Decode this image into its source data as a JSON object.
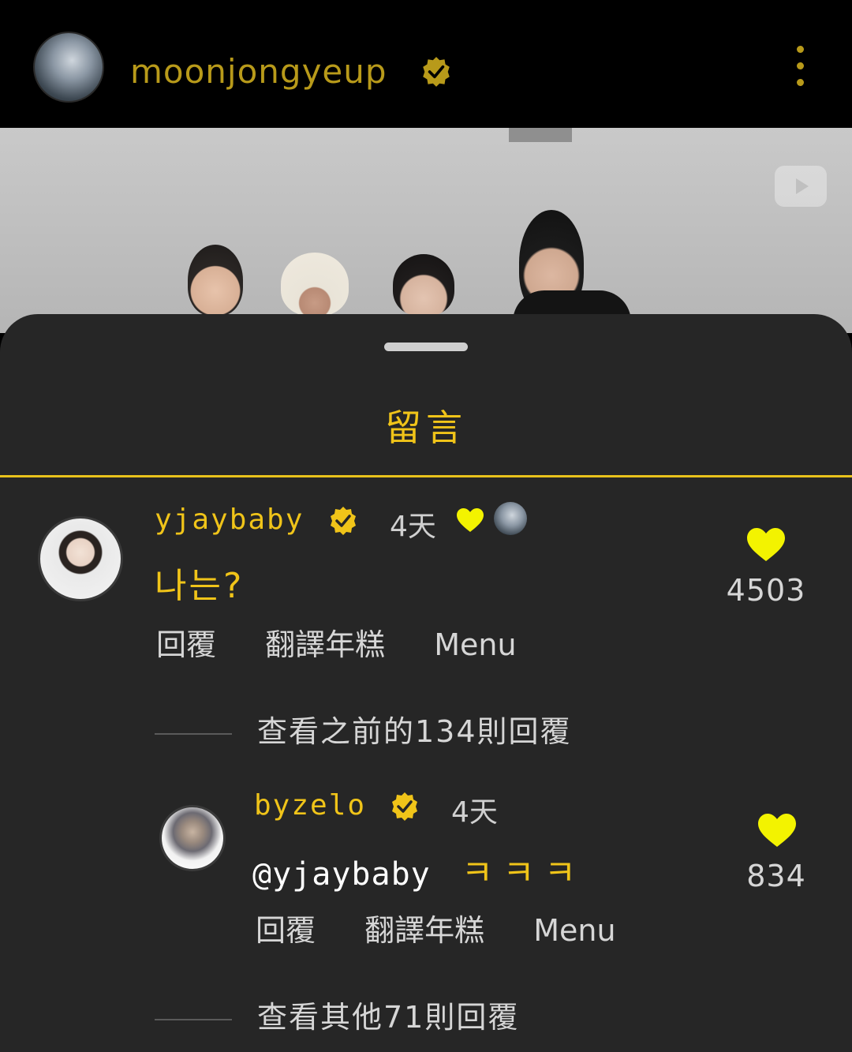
{
  "header": {
    "username": "moonjongyeup"
  },
  "sheet": {
    "title": "留言"
  },
  "comments": [
    {
      "username": "yjaybaby",
      "time": "4天",
      "text": "나는?",
      "actions": {
        "reply": "回覆",
        "translate": "翻譯年糕",
        "menu": "Menu"
      },
      "likes": "4503",
      "view_replies": "查看之前的134則回覆"
    },
    {
      "username": "byzelo",
      "time": "4天",
      "mention": "@yjaybaby",
      "text": "ㅋㅋㅋ",
      "actions": {
        "reply": "回覆",
        "translate": "翻譯年糕",
        "menu": "Menu"
      },
      "likes": "834",
      "view_replies": "查看其他71則回覆"
    }
  ],
  "colors": {
    "accent": "#f0c419",
    "heart": "#f3f300",
    "sheet_bg": "#262626",
    "header_username": "#b89a1a"
  }
}
